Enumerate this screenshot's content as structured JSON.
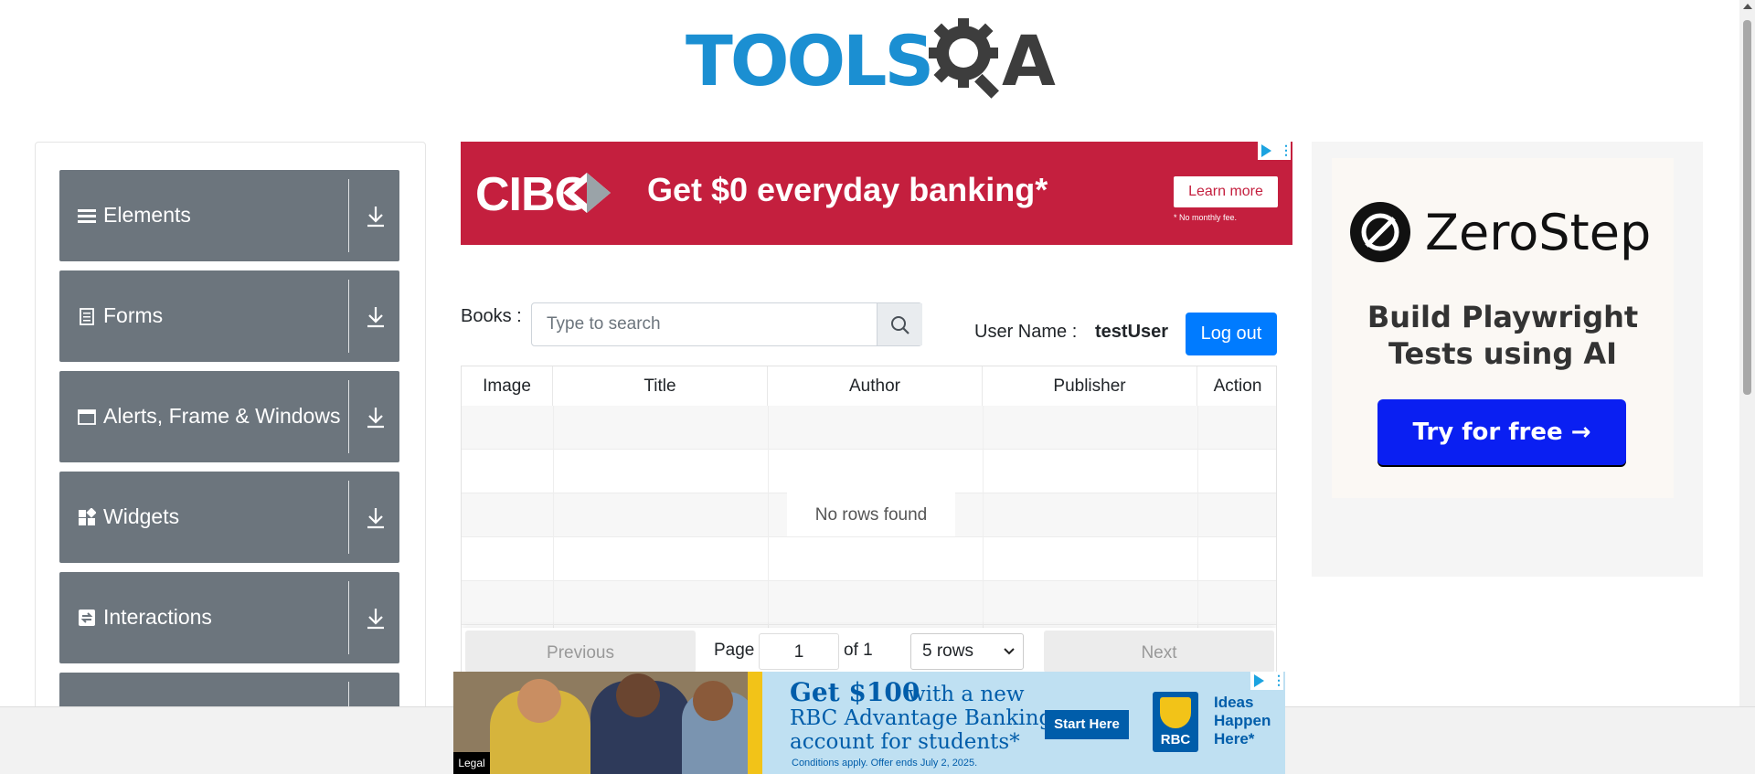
{
  "brand": {
    "logo_tools": "TOOLS",
    "logo_a": "A",
    "colors": {
      "blue": "#1b8fd2",
      "dark": "#3d3d3d"
    }
  },
  "sidebar": {
    "groups": [
      {
        "label": "Elements",
        "icon": "hamburger-icon"
      },
      {
        "label": "Forms",
        "icon": "document-icon"
      },
      {
        "label": "Alerts, Frame & Windows",
        "icon": "window-icon"
      },
      {
        "label": "Widgets",
        "icon": "widgets-icon"
      },
      {
        "label": "Interactions",
        "icon": "interactions-icon"
      }
    ]
  },
  "ad_top": {
    "brand": "CIBC",
    "headline": "Get $0 everyday banking*",
    "cta": "Learn more",
    "fine_print": "* No monthly fee."
  },
  "books": {
    "label": "Books :",
    "search_placeholder": "Type to search",
    "user_label": "User Name :",
    "user_value": "testUser",
    "logout_label": "Log out"
  },
  "table": {
    "columns": [
      "Image",
      "Title",
      "Author",
      "Publisher",
      "Action"
    ],
    "empty_text": "No rows found",
    "pagination": {
      "previous": "Previous",
      "page_label": "Page",
      "page_value": "1",
      "of_label": "of 1",
      "rows_option": "5 rows",
      "next": "Next"
    }
  },
  "ad_right": {
    "brand": "ZeroStep",
    "tagline_line1": "Build Playwright",
    "tagline_line2": "Tests using AI",
    "cta": "Try for free →"
  },
  "ad_bottom": {
    "headline_bold": "Get $100",
    "headline_rest": "with a new",
    "line2": "RBC Advantage Banking",
    "line3": "account for students*",
    "fine_print": "Conditions apply. Offer ends July 2, 2025.",
    "cta": "Start Here",
    "logo_text": "RBC",
    "slogan_1": "Ideas",
    "slogan_2": "Happen",
    "slogan_3": "Here*",
    "legal": "Legal"
  }
}
